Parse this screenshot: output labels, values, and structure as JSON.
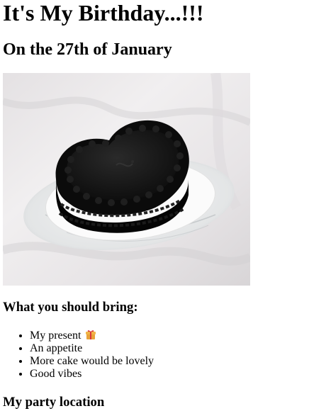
{
  "page": {
    "title": "It's My Birthday...!!!",
    "subtitle": "On the 27th of January",
    "bring_heading": "What you should bring:",
    "items": [
      {
        "label": "My present",
        "icon": "gift-icon"
      },
      {
        "label": "An appetite"
      },
      {
        "label": "More cake would be lovely"
      },
      {
        "label": "Good vibes"
      }
    ],
    "location_heading": "My party location"
  },
  "colors": {
    "text": "#000000",
    "background": "#ffffff",
    "gift_box": "#e8a33a",
    "gift_ribbon": "#d9363e"
  }
}
